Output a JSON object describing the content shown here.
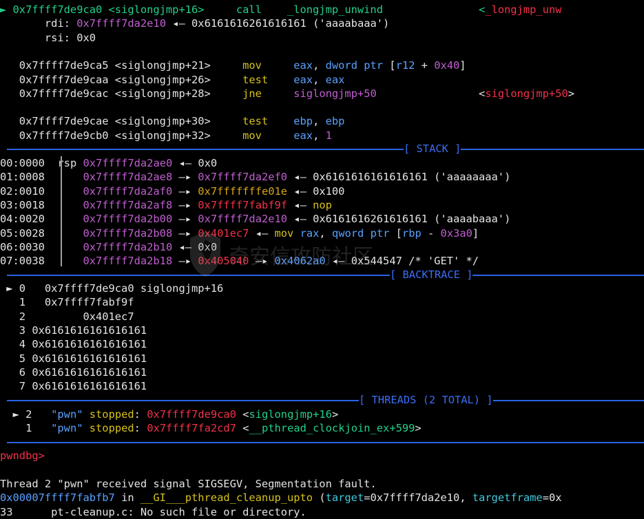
{
  "colors": {
    "fg": "#e4e4e4",
    "green": "#23d18b",
    "purple": "#c05fd0",
    "magenta": "#b545d0",
    "yellow": "#d7c21b",
    "red": "#f3314a",
    "blue": "#5aa0ff",
    "cyan": "#3fc9df",
    "orange": "#d8a514",
    "sepBlue": "#2b63e6"
  },
  "watermark": {
    "text": "奇安信攻防社区",
    "icon": "shield-icon"
  },
  "disasm": [
    {
      "id": "disasm-current",
      "segs": [
        [
          "► 0x7ffff7de9ca0 <siglongjmp+16>     call    _longjmp_unwind               <",
          "green"
        ],
        [
          "_longjmp_unw",
          "red"
        ]
      ]
    },
    {
      "id": "disasm-arg-rdi",
      "segs": [
        [
          "       ",
          "fg"
        ],
        [
          "rdi",
          "fg"
        ],
        [
          ": ",
          "fg"
        ],
        [
          "0x7ffff7da2e10",
          "purple"
        ],
        [
          " ◂— 0x6161616261616161 ('aaaabaaa')",
          "fg"
        ]
      ]
    },
    {
      "id": "disasm-arg-rsi",
      "segs": [
        [
          "       rsi: 0x0",
          "fg"
        ]
      ]
    },
    {
      "id": "disasm-blank-1",
      "segs": [
        [
          "",
          "fg"
        ]
      ]
    },
    {
      "id": "disasm-line",
      "segs": [
        [
          "   0x7ffff7de9ca5 <siglongjmp+21>     ",
          "fg"
        ],
        [
          "mov",
          "yellow"
        ],
        [
          "     ",
          "fg"
        ],
        [
          "eax",
          "blue"
        ],
        [
          ", ",
          "fg"
        ],
        [
          "dword ptr",
          "blue"
        ],
        [
          " [",
          "fg"
        ],
        [
          "r12",
          "blue"
        ],
        [
          " + ",
          "fg"
        ],
        [
          "0x40",
          "purple"
        ],
        [
          "]",
          "fg"
        ]
      ]
    },
    {
      "id": "disasm-line",
      "segs": [
        [
          "   0x7ffff7de9caa <siglongjmp+26>     ",
          "fg"
        ],
        [
          "test",
          "yellow"
        ],
        [
          "    ",
          "fg"
        ],
        [
          "eax",
          "blue"
        ],
        [
          ", ",
          "fg"
        ],
        [
          "eax",
          "blue"
        ]
      ]
    },
    {
      "id": "disasm-line",
      "segs": [
        [
          "   0x7ffff7de9cac <siglongjmp+28>     ",
          "fg"
        ],
        [
          "jne",
          "yellow"
        ],
        [
          "     ",
          "fg"
        ],
        [
          "siglongjmp+50",
          "purple"
        ],
        [
          "                <",
          "fg"
        ],
        [
          "siglongjmp+50",
          "red"
        ],
        [
          ">",
          "fg"
        ]
      ]
    },
    {
      "id": "disasm-blank-2",
      "segs": [
        [
          "",
          "fg"
        ]
      ]
    },
    {
      "id": "disasm-line",
      "segs": [
        [
          "   0x7ffff7de9cae <siglongjmp+30>     ",
          "fg"
        ],
        [
          "test",
          "yellow"
        ],
        [
          "    ",
          "fg"
        ],
        [
          "ebp",
          "blue"
        ],
        [
          ", ",
          "fg"
        ],
        [
          "ebp",
          "blue"
        ]
      ]
    },
    {
      "id": "disasm-line",
      "segs": [
        [
          "   0x7ffff7de9cb0 <siglongjmp+32>     ",
          "fg"
        ],
        [
          "mov",
          "yellow"
        ],
        [
          "     ",
          "fg"
        ],
        [
          "eax",
          "blue"
        ],
        [
          ", ",
          "fg"
        ],
        [
          "1",
          "purple"
        ]
      ]
    }
  ],
  "stack": [
    {
      "id": "stack-row",
      "segs": [
        [
          "00:0000",
          "fg"
        ],
        [
          "  ",
          "fg"
        ],
        [
          "rsp",
          "fg"
        ],
        [
          " ",
          "fg"
        ],
        [
          "0x7ffff7da2ae0",
          "purple"
        ],
        [
          " ◂— 0x0",
          "fg"
        ]
      ]
    },
    {
      "id": "stack-row",
      "segs": [
        [
          "01:0008",
          "fg"
        ],
        [
          "      ",
          "fg"
        ],
        [
          "0x7ffff7da2ae8",
          "purple"
        ],
        [
          " —▸ ",
          "fg"
        ],
        [
          "0x7ffff7da2ef0",
          "purple"
        ],
        [
          " ◂— 0x6161616161616161 ('aaaaaaaa')",
          "fg"
        ]
      ]
    },
    {
      "id": "stack-row",
      "segs": [
        [
          "02:0010",
          "fg"
        ],
        [
          "      ",
          "fg"
        ],
        [
          "0x7ffff7da2af0",
          "purple"
        ],
        [
          " —▸ ",
          "fg"
        ],
        [
          "0x7fffffffe01e",
          "orange"
        ],
        [
          " ◂— 0x100",
          "fg"
        ]
      ]
    },
    {
      "id": "stack-row",
      "segs": [
        [
          "03:0018",
          "fg"
        ],
        [
          "      ",
          "fg"
        ],
        [
          "0x7ffff7da2af8",
          "purple"
        ],
        [
          " —▸ ",
          "fg"
        ],
        [
          "0x7ffff7fabf9f",
          "red"
        ],
        [
          " ◂— ",
          "fg"
        ],
        [
          "nop",
          "yellow"
        ]
      ]
    },
    {
      "id": "stack-row",
      "segs": [
        [
          "04:0020",
          "fg"
        ],
        [
          "      ",
          "fg"
        ],
        [
          "0x7ffff7da2b00",
          "purple"
        ],
        [
          " —▸ ",
          "fg"
        ],
        [
          "0x7ffff7da2e10",
          "purple"
        ],
        [
          " ◂— 0x6161616261616161 ('aaaabaaa')",
          "fg"
        ]
      ]
    },
    {
      "id": "stack-row",
      "segs": [
        [
          "05:0028",
          "fg"
        ],
        [
          "      ",
          "fg"
        ],
        [
          "0x7ffff7da2b08",
          "purple"
        ],
        [
          " —▸ ",
          "fg"
        ],
        [
          "0x401ec7",
          "red"
        ],
        [
          " ◂— ",
          "fg"
        ],
        [
          "mov",
          "yellow"
        ],
        [
          " ",
          "fg"
        ],
        [
          "rax",
          "blue"
        ],
        [
          ", ",
          "fg"
        ],
        [
          "qword ptr",
          "blue"
        ],
        [
          " [",
          "fg"
        ],
        [
          "rbp",
          "blue"
        ],
        [
          " - ",
          "fg"
        ],
        [
          "0x3a0",
          "purple"
        ],
        [
          "]",
          "fg"
        ]
      ]
    },
    {
      "id": "stack-row",
      "segs": [
        [
          "06:0030",
          "fg"
        ],
        [
          "      ",
          "fg"
        ],
        [
          "0x7ffff7da2b10",
          "purple"
        ],
        [
          " ◂— 0x0",
          "fg"
        ]
      ]
    },
    {
      "id": "stack-row",
      "segs": [
        [
          "07:0038",
          "fg"
        ],
        [
          "      ",
          "fg"
        ],
        [
          "0x7ffff7da2b18",
          "purple"
        ],
        [
          " —▸ ",
          "fg"
        ],
        [
          "0x405040",
          "red"
        ],
        [
          " —▸ ",
          "fg"
        ],
        [
          "0x4062a0",
          "blue"
        ],
        [
          " ◂— 0x544547 /* 'GET' */",
          "fg"
        ]
      ]
    }
  ],
  "backtrace": [
    {
      "id": "backtrace-frame",
      "segs": [
        [
          " ► 0   0x7ffff7de9ca0 siglongjmp+16",
          "fg"
        ]
      ]
    },
    {
      "id": "backtrace-frame",
      "segs": [
        [
          "   1   0x7ffff7fabf9f",
          "fg"
        ]
      ]
    },
    {
      "id": "backtrace-frame",
      "segs": [
        [
          "   2         0x401ec7",
          "fg"
        ]
      ]
    },
    {
      "id": "backtrace-frame",
      "segs": [
        [
          "   3 0x6161616161616161",
          "fg"
        ]
      ]
    },
    {
      "id": "backtrace-frame",
      "segs": [
        [
          "   4 0x6161616161616161",
          "fg"
        ]
      ]
    },
    {
      "id": "backtrace-frame",
      "segs": [
        [
          "   5 0x6161616161616161",
          "fg"
        ]
      ]
    },
    {
      "id": "backtrace-frame",
      "segs": [
        [
          "   6 0x6161616161616161",
          "fg"
        ]
      ]
    },
    {
      "id": "backtrace-frame",
      "segs": [
        [
          "   7 0x6161616161616161",
          "fg"
        ]
      ]
    }
  ],
  "threads": [
    {
      "id": "thread-row",
      "segs": [
        [
          "  ► 2   ",
          "fg"
        ],
        [
          "\"pwn\"",
          "blue"
        ],
        [
          " ",
          "fg"
        ],
        [
          "stopped",
          "yellow"
        ],
        [
          ": ",
          "fg"
        ],
        [
          "0x7ffff7de9ca0",
          "red"
        ],
        [
          " <",
          "fg"
        ],
        [
          "siglongjmp+16",
          "green"
        ],
        [
          ">",
          "fg"
        ]
      ]
    },
    {
      "id": "thread-row",
      "segs": [
        [
          "    1   ",
          "fg"
        ],
        [
          "\"pwn\"",
          "blue"
        ],
        [
          " ",
          "fg"
        ],
        [
          "stopped",
          "yellow"
        ],
        [
          ": ",
          "fg"
        ],
        [
          "0x7ffff7fa2cd7",
          "red"
        ],
        [
          " <",
          "fg"
        ],
        [
          "__pthread_clockjoin_ex+599",
          "green"
        ],
        [
          ">",
          "fg"
        ]
      ]
    }
  ],
  "prompt": {
    "text": "pwndbg>"
  },
  "footer": [
    {
      "id": "signal-message",
      "segs": [
        [
          "Thread 2 \"pwn\" received signal SIGSEGV, Segmentation fault.",
          "fg"
        ]
      ]
    },
    {
      "id": "fault-frame",
      "segs": [
        [
          "0x00007ffff7fabfb7",
          "blue"
        ],
        [
          " in ",
          "fg"
        ],
        [
          "__GI___pthread_cleanup_upto",
          "yellow"
        ],
        [
          " (",
          "fg"
        ],
        [
          "target",
          "cyan"
        ],
        [
          "=0x7ffff7da2e10, ",
          "fg"
        ],
        [
          "targetframe",
          "cyan"
        ],
        [
          "=0x",
          "fg"
        ]
      ]
    },
    {
      "id": "source-line",
      "segs": [
        [
          "33      pt-cleanup.c: No such file or directory.",
          "fg"
        ]
      ]
    }
  ],
  "sections": {
    "stack": "[ STACK ]",
    "backtrace": "[ BACKTRACE ]",
    "threads": "[ THREADS (2 TOTAL) ]"
  }
}
